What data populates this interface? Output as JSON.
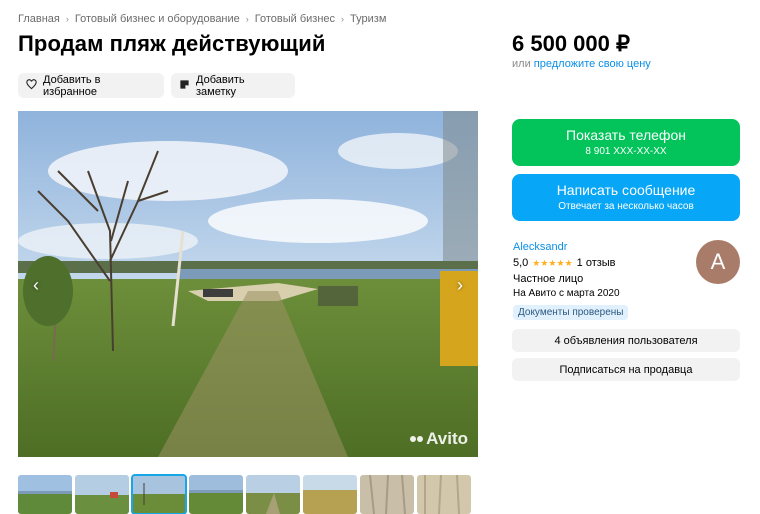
{
  "breadcrumb": [
    "Главная",
    "Готовый бизнес и оборудование",
    "Готовый бизнес",
    "Туризм"
  ],
  "listing": {
    "title": "Продам пляж действующий",
    "price": "6 500 000 ₽",
    "price_prefix": "или",
    "price_link": "предложите свою цену"
  },
  "actions": {
    "favorite_label": "Добавить в избранное",
    "note_label": "Добавить заметку"
  },
  "gallery": {
    "watermark": "Avito",
    "thumbnail_count": 8,
    "active_thumbnail": 3
  },
  "contact": {
    "phone_label": "Показать телефон",
    "phone_number": "8 901 XXX-XX-XX",
    "message_label": "Написать сообщение",
    "message_sub": "Отвечает за несколько часов"
  },
  "seller": {
    "name": "Alecksandr",
    "rating": "5,0",
    "stars": "★★★★★",
    "reviews": "1 отзыв",
    "type": "Частное лицо",
    "since": "На Авито с марта 2020",
    "verified": "Документы проверены",
    "avatar_letter": "A",
    "listings_label": "4 объявления пользователя",
    "subscribe_label": "Подписаться на продавца"
  },
  "colors": {
    "phone_button": "#02c45a",
    "message_button": "#08a6f6",
    "link": "#0a8fe6",
    "avatar": "#a97c6a"
  }
}
